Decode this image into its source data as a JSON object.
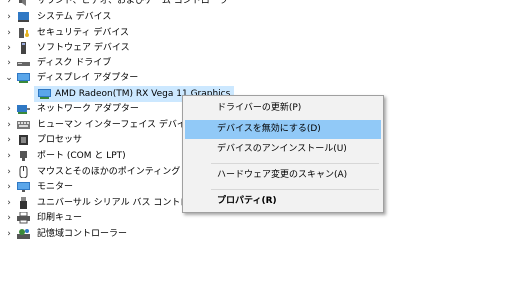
{
  "tree": {
    "items": [
      {
        "label": "サウンド、ビデオ、およびゲーム コントローラー",
        "expanded": false,
        "icon": "speaker-icon"
      },
      {
        "label": "システム デバイス",
        "expanded": false,
        "icon": "system-device-icon"
      },
      {
        "label": "セキュリティ デバイス",
        "expanded": false,
        "icon": "security-key-icon"
      },
      {
        "label": "ソフトウェア デバイス",
        "expanded": false,
        "icon": "software-device-icon"
      },
      {
        "label": "ディスク ドライブ",
        "expanded": false,
        "icon": "disk-drive-icon"
      },
      {
        "label": "ディスプレイ アダプター",
        "expanded": true,
        "icon": "display-adapter-icon"
      },
      {
        "label": "AMD Radeon(TM) RX Vega 11 Graphics",
        "child": true,
        "selected": true,
        "icon": "display-adapter-icon"
      },
      {
        "label": "ネットワーク アダプター",
        "expanded": false,
        "icon": "network-adapter-icon"
      },
      {
        "label": "ヒューマン インターフェイス デバイス",
        "expanded": false,
        "icon": "hid-icon"
      },
      {
        "label": "プロセッサ",
        "expanded": false,
        "icon": "processor-icon"
      },
      {
        "label": "ポート (COM と LPT)",
        "expanded": false,
        "icon": "port-icon"
      },
      {
        "label": "マウスとそのほかのポインティング デバイス",
        "expanded": false,
        "icon": "mouse-icon"
      },
      {
        "label": "モニター",
        "expanded": false,
        "icon": "monitor-icon"
      },
      {
        "label": "ユニバーサル シリアル バス コントローラー",
        "expanded": false,
        "icon": "usb-icon"
      },
      {
        "label": "印刷キュー",
        "expanded": false,
        "icon": "printer-icon"
      },
      {
        "label": "記憶域コントローラー",
        "expanded": false,
        "icon": "storage-controller-icon"
      }
    ]
  },
  "context_menu": {
    "items": [
      {
        "label": "ドライバーの更新(P)",
        "hover": false,
        "bold": false
      },
      {
        "label": "デバイスを無効にする(D)",
        "hover": true,
        "bold": false
      },
      {
        "label": "デバイスのアンインストール(U)",
        "hover": false,
        "bold": false
      },
      {
        "label": "ハードウェア変更のスキャン(A)",
        "hover": false,
        "bold": false
      },
      {
        "label": "プロパティ(R)",
        "hover": false,
        "bold": true
      }
    ]
  },
  "colors": {
    "selection": "#cce8ff",
    "menu_hover": "#91c9f7",
    "menu_background": "#f2f2f2",
    "icon_blue": "#2f78c4"
  }
}
